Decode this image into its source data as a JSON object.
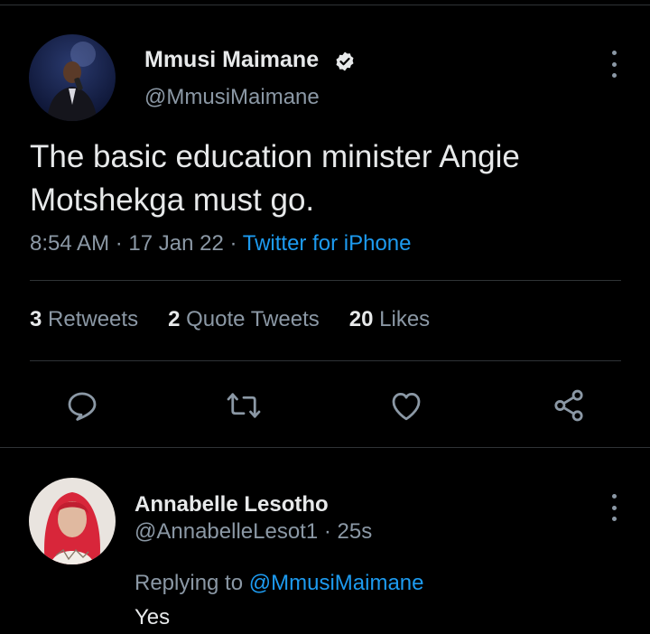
{
  "tweet": {
    "author_name": "Mmusi Maimane",
    "author_handle": "@MmusiMaimane",
    "text": "The basic education minister Angie Motshekga must go.",
    "time": "8:54 AM",
    "date": "17 Jan 22",
    "separator": "·",
    "source": "Twitter for iPhone",
    "stats": {
      "retweets_count": "3",
      "retweets_label": "Retweets",
      "quotes_count": "2",
      "quotes_label": "Quote Tweets",
      "likes_count": "20",
      "likes_label": "Likes"
    },
    "actions": [
      "reply-icon",
      "retweet-icon",
      "like-icon",
      "share-icon"
    ]
  },
  "reply": {
    "author_name": "Annabelle Lesotho",
    "author_handle": "@AnnabelleLesot1",
    "age": "25s",
    "replying_prefix": "Replying to",
    "replying_to": "@MmusiMaimane",
    "text": "Yes"
  },
  "colors": {
    "background": "#000000",
    "text": "#e7e9ea",
    "secondary": "#8b98a5",
    "accent": "#1d9bf0",
    "divider": "#2f3336"
  }
}
